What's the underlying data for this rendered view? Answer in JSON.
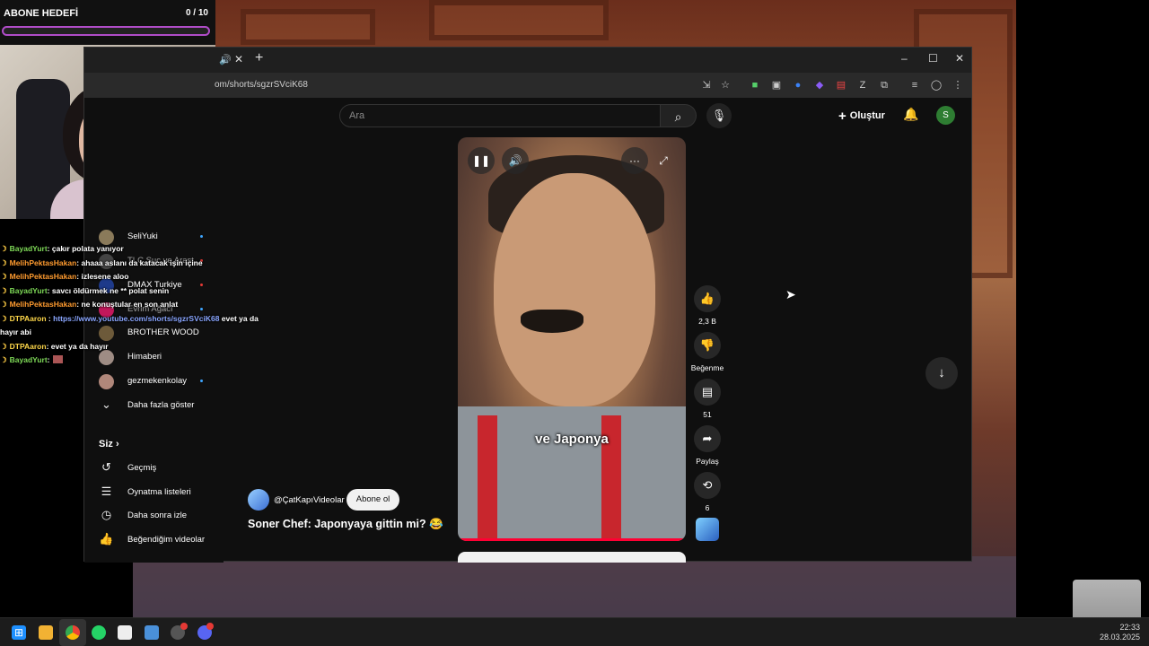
{
  "goal": {
    "title": "ABONE HEDEFİ",
    "count": "0 / 10",
    "progress": 0
  },
  "chat": [
    {
      "user": "BayadYurt",
      "color": "green",
      "text": ": çakır polata yanıyor"
    },
    {
      "user": "MelihPektasHakan",
      "color": "orange",
      "text": ": ahaaa aslanı da katacak işin içine"
    },
    {
      "user": "MelihPektasHakan",
      "color": "orange",
      "text": ": izlesene aloo"
    },
    {
      "user": "BayadYurt",
      "color": "green",
      "text": ": savcı öldürmek ne ** polat senin"
    },
    {
      "user": "MelihPektasHakan",
      "color": "orange",
      "text": ": ne konuştular en son anlat"
    },
    {
      "user": "DTPAaron",
      "color": "yellow",
      "link": "https://www.youtube.com/shorts/sgzrSVciK68",
      "text": " evet ya da",
      "cont": "hayır abi"
    },
    {
      "user": "DTPAaron",
      "color": "yellow",
      "text": ": evet ya da hayır"
    },
    {
      "user": "BayadYurt",
      "color": "green",
      "text": ":"
    }
  ],
  "browser": {
    "url": "om/shorts/sgzrSVciK68",
    "search_placeholder": "Ara",
    "create_label": "Oluştur",
    "avatar_letter": "S"
  },
  "subscriptions": [
    {
      "name": "SeliYuki"
    },
    {
      "name": "TLC Suç ve Araşt"
    },
    {
      "name": "DMAX Turkiye"
    },
    {
      "name": "Evrim Ağacı"
    },
    {
      "name": "BROTHER WOOD"
    },
    {
      "name": "Himaberi"
    },
    {
      "name": "gezmekenkolay"
    }
  ],
  "sidebar": {
    "show_more": "Daha fazla göster",
    "you": "Siz",
    "items": [
      {
        "label": "Geçmiş",
        "icon": "history-icon"
      },
      {
        "label": "Oynatma listeleri",
        "icon": "playlist-icon"
      },
      {
        "label": "Daha sonra izle",
        "icon": "clock-icon"
      },
      {
        "label": "Beğendiğim videolar",
        "icon": "thumb-up-icon"
      }
    ]
  },
  "short": {
    "caption": "ve Japonya",
    "channel": "@ÇatKapıVideolar",
    "subscribe": "Abone ol",
    "title": "Soner Chef: Japonyaya gittin mi? 😂",
    "progress": 1.0,
    "likes": "2,3 B",
    "dislike_label": "Beğenme",
    "comments": "51",
    "share_label": "Paylaş",
    "remix": "6"
  },
  "taskbar": {
    "time": "22:33",
    "date": "28.03.2025"
  }
}
